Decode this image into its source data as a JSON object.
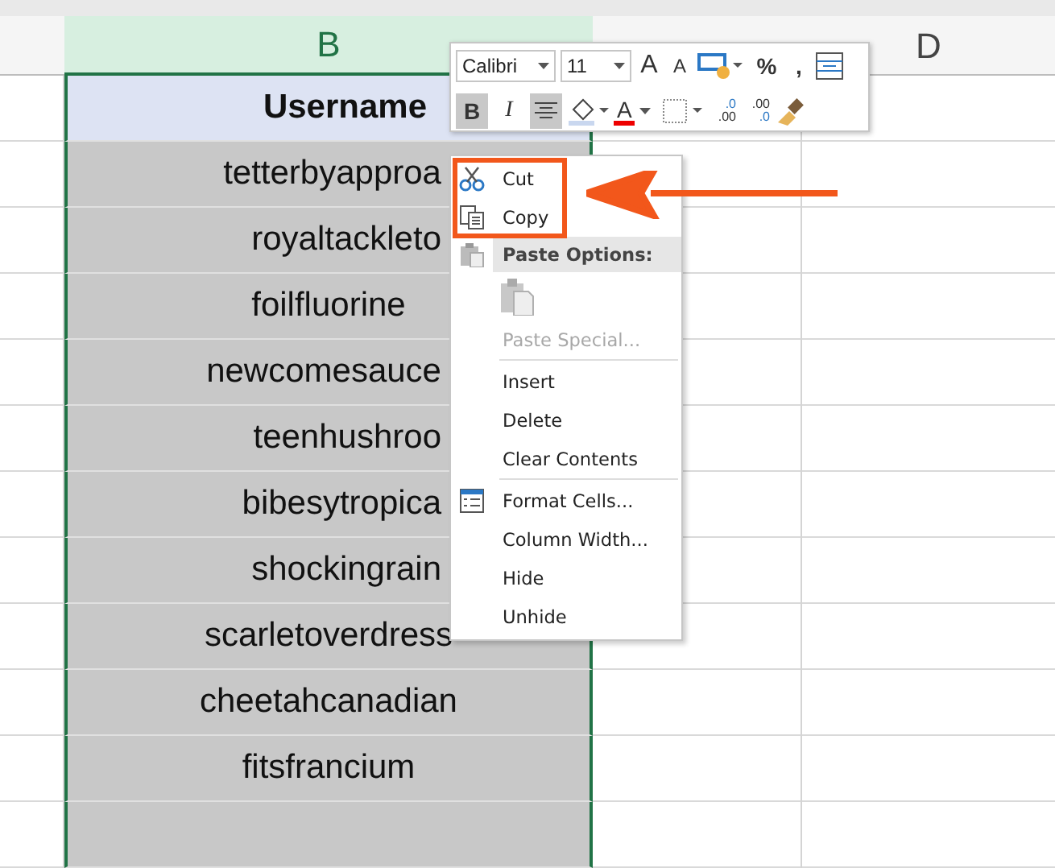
{
  "sheet": {
    "columns": [
      {
        "label": "B",
        "selected": true
      },
      {
        "label": "D",
        "selected": false
      }
    ],
    "header_cell": "Username",
    "rows": [
      {
        "text": "tetterbyapproa",
        "kind": "cut"
      },
      {
        "text": "royaltackleto",
        "kind": "cut"
      },
      {
        "text": "foilfluorine",
        "kind": "full"
      },
      {
        "text": "newcomesauce",
        "kind": "cut"
      },
      {
        "text": "teenhushroo",
        "kind": "cut"
      },
      {
        "text": "bibesytropica",
        "kind": "cut"
      },
      {
        "text": "shockingrain",
        "kind": "cut"
      },
      {
        "text": "scarletoverdress",
        "kind": "full"
      },
      {
        "text": "cheetahcanadian",
        "kind": "full"
      },
      {
        "text": "fitsfrancium",
        "kind": "full"
      },
      {
        "text": "",
        "kind": "full"
      }
    ]
  },
  "mini_toolbar": {
    "font": "Calibri",
    "size": "11",
    "grow_font": "A",
    "shrink_font": "A",
    "percent": "%",
    "comma": ",",
    "bold": "B",
    "italic": "I",
    "align_selected": true,
    "font_color": "A",
    "increase_decimal": [
      ".0",
      ".00"
    ],
    "decrease_decimal": [
      ".00",
      ".0"
    ]
  },
  "context_menu": {
    "items": [
      {
        "kind": "item",
        "label": "Cut",
        "highlighted": true
      },
      {
        "kind": "item",
        "label": "Copy",
        "highlighted": true
      },
      {
        "kind": "heading",
        "label": "Paste Options:"
      },
      {
        "kind": "paste"
      },
      {
        "kind": "disabled",
        "label": "Paste Special..."
      },
      {
        "kind": "separator"
      },
      {
        "kind": "item",
        "label": "Insert"
      },
      {
        "kind": "item",
        "label": "Delete"
      },
      {
        "kind": "item",
        "label": "Clear Contents"
      },
      {
        "kind": "separator"
      },
      {
        "kind": "item",
        "label": "Format Cells..."
      },
      {
        "kind": "item",
        "label": "Column Width..."
      },
      {
        "kind": "item",
        "label": "Hide"
      },
      {
        "kind": "item",
        "label": "Unhide"
      }
    ]
  }
}
